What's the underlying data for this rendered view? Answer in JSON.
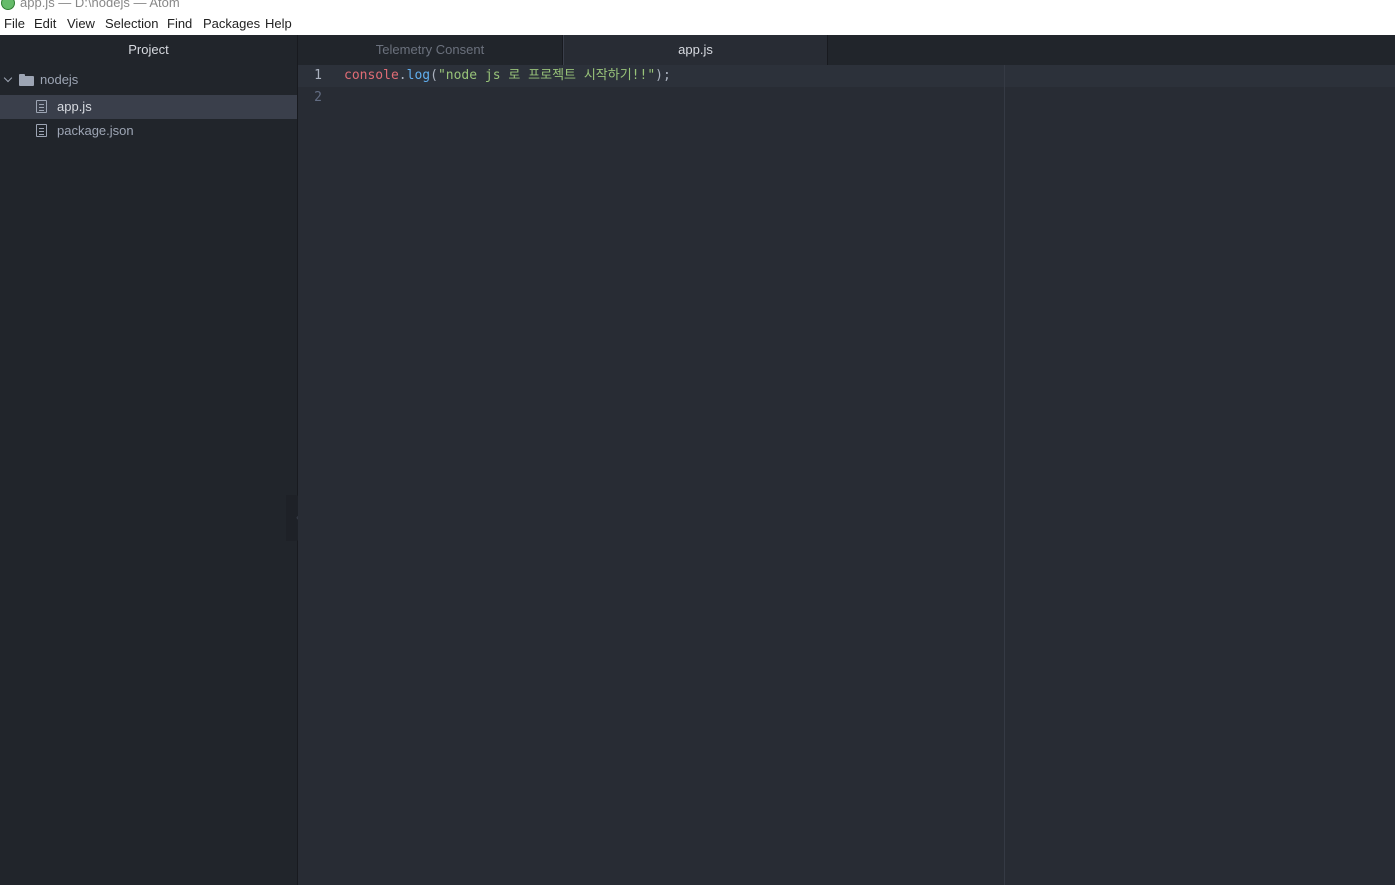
{
  "window": {
    "title": "app.js — D:\\nodejs — Atom"
  },
  "menu": [
    "File",
    "Edit",
    "View",
    "Selection",
    "Find",
    "Packages",
    "Help"
  ],
  "sidebar": {
    "title": "Project",
    "root": "nodejs",
    "files": [
      {
        "name": "app.js",
        "selected": true
      },
      {
        "name": "package.json",
        "selected": false
      }
    ]
  },
  "tabs": [
    {
      "label": "Telemetry Consent",
      "active": false
    },
    {
      "label": "app.js",
      "active": true
    }
  ],
  "editor": {
    "line_numbers": [
      "1",
      "2"
    ],
    "code": {
      "object": "console",
      "dot": ".",
      "method": "log",
      "open": "(",
      "string": "\"node js 로 프로젝트 시작하기!!\"",
      "close": ");"
    }
  },
  "colors": {
    "keyword": "#e06c75",
    "function": "#61afef",
    "string": "#98c379",
    "punctuation": "#abb2bf",
    "line_number_active": "#abb2bf",
    "line_number": "#636d83"
  },
  "icons": [
    "atom-logo-icon",
    "chevron-down-icon",
    "folder-icon",
    "file-icon",
    "chevron-left-icon"
  ]
}
